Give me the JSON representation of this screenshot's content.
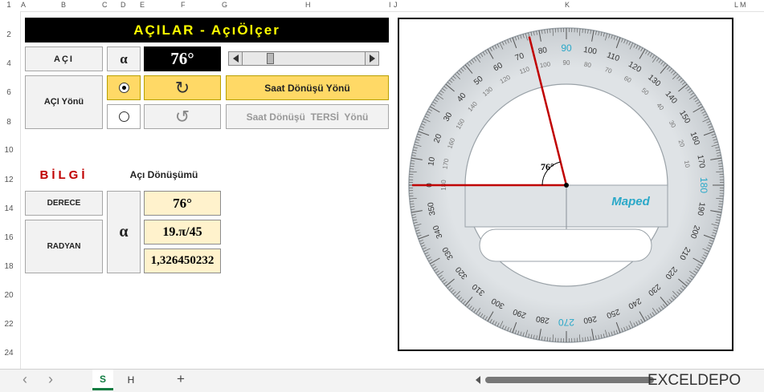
{
  "title": "AÇILAR - AçıÖlçer",
  "columns": [
    "A",
    "B",
    "C",
    "D",
    "E",
    "F",
    "G",
    "H",
    "I",
    "J",
    "K",
    "L",
    "M"
  ],
  "rows": [
    "1",
    "2",
    "4",
    "6",
    "8",
    "10",
    "12",
    "14",
    "16",
    "18",
    "20",
    "22",
    "24"
  ],
  "aci_label": "AÇI",
  "alpha": "α",
  "angle_display": "76°",
  "slider_value": 76,
  "slider_max": 360,
  "aci_yonu_label": "AÇI Yönü",
  "clockwise_btn": "Saat Dönüşü Yönü",
  "counter_btn": "Saat Dönüşü  TERSİ  Yönü",
  "rotate_cw_icon": "↻",
  "rotate_ccw_icon": "↺",
  "bilgi": "BİLGİ",
  "aci_donusumu": "Açı Dönüşümü",
  "derece_label": "DERECE",
  "radyan_label": "RADYAN",
  "derece_value": "76°",
  "radyan_pi": "19.π/45",
  "radyan_value": "1,326450232",
  "protractor": {
    "angle_label": "76°",
    "angle": 76,
    "brand": "Maped",
    "outer_labels": [
      "0",
      "10",
      "20",
      "30",
      "40",
      "50",
      "60",
      "70",
      "80",
      "90",
      "100",
      "110",
      "120",
      "130",
      "140",
      "150",
      "160",
      "170",
      "180",
      "190",
      "200",
      "210",
      "220",
      "230",
      "240",
      "250",
      "260",
      "270",
      "280",
      "290",
      "300",
      "310",
      "320",
      "330",
      "340",
      "350"
    ],
    "inner_labels": [
      "180",
      "170",
      "160",
      "150",
      "140",
      "130",
      "120",
      "110",
      "100",
      "90",
      "80",
      "70",
      "60",
      "50",
      "40",
      "30",
      "20",
      "10"
    ]
  },
  "sheet_tabs": [
    "S",
    "H"
  ],
  "add_sheet": "+",
  "nav_prev": "‹",
  "nav_next": "›",
  "logo": "EXCELDEPO",
  "colors": {
    "title_bg": "#000000",
    "title_fg": "#ffff00",
    "accent": "#c00000",
    "yellow": "#ffd966",
    "ybox": "#fff2cc"
  }
}
